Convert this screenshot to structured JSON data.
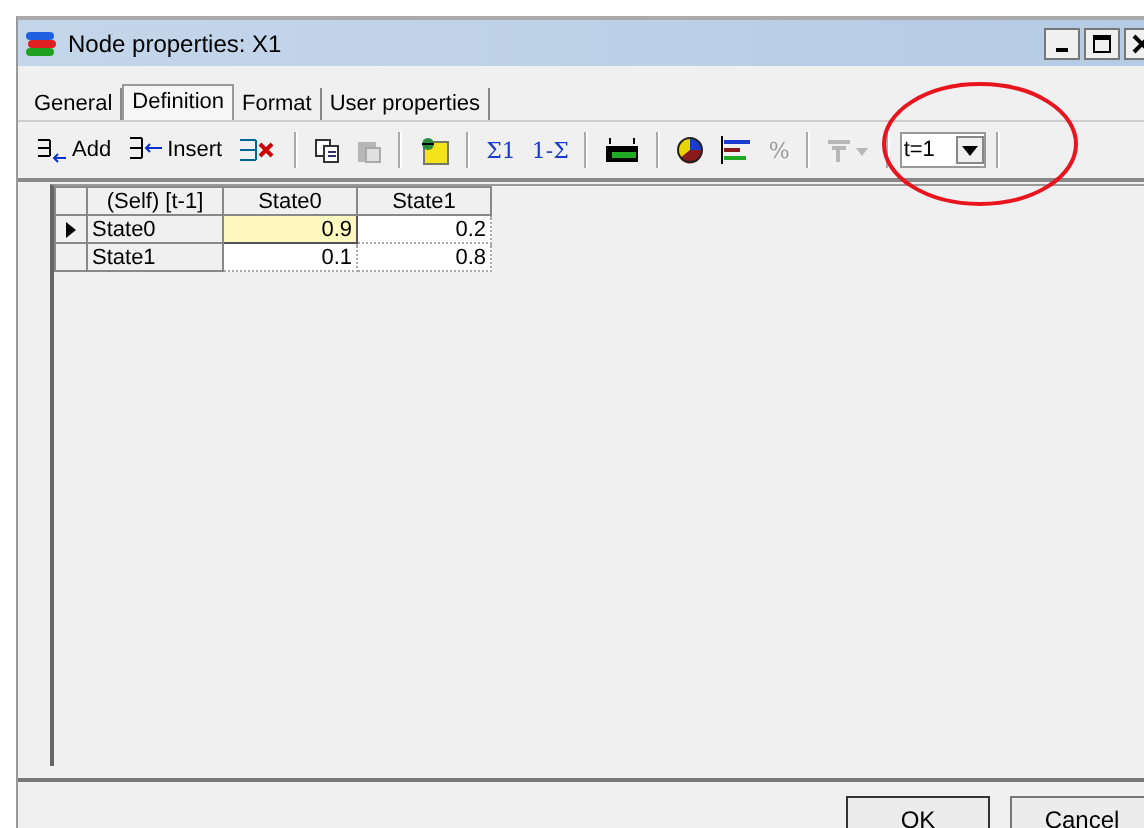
{
  "window": {
    "title": "Node properties: X1"
  },
  "tabs": [
    {
      "label": "General",
      "selected": false
    },
    {
      "label": "Definition",
      "selected": true
    },
    {
      "label": "Format",
      "selected": false
    },
    {
      "label": "User properties",
      "selected": false
    }
  ],
  "toolbar": [
    {
      "kind": "button",
      "label": "Add",
      "disabled": false
    },
    {
      "kind": "button",
      "label": "Insert",
      "disabled": false
    },
    {
      "kind": "button",
      "disabled": false
    },
    {
      "kind": "separator"
    },
    {
      "kind": "button",
      "disabled": false
    },
    {
      "kind": "button",
      "disabled": true
    },
    {
      "kind": "separator"
    },
    {
      "kind": "button",
      "disabled": false
    },
    {
      "kind": "separator"
    },
    {
      "kind": "button",
      "label": "Σ1",
      "disabled": false
    },
    {
      "kind": "button",
      "label": "1-Σ",
      "disabled": false
    },
    {
      "kind": "separator"
    },
    {
      "kind": "button",
      "disabled": false
    },
    {
      "kind": "separator"
    },
    {
      "kind": "button",
      "disabled": false
    },
    {
      "kind": "button",
      "disabled": false
    },
    {
      "kind": "button",
      "label": "%",
      "disabled": true
    },
    {
      "kind": "separator"
    },
    {
      "kind": "button",
      "disabled": true
    },
    {
      "kind": "separator"
    },
    {
      "kind": "combo",
      "value": "t=1"
    },
    {
      "kind": "separator"
    }
  ],
  "table": {
    "columns": [
      "(Self) [t-1]",
      "State0",
      "State1"
    ],
    "rows": [
      {
        "selected": true,
        "cells": [
          {
            "text": "State0"
          },
          {
            "text": "0.9",
            "selected": true
          },
          {
            "text": "0.2",
            "selected": false
          }
        ]
      },
      {
        "selected": false,
        "cells": [
          {
            "text": "State1"
          },
          {
            "text": "0.1",
            "selected": false
          },
          {
            "text": "0.8",
            "selected": false
          }
        ]
      }
    ]
  },
  "buttons": [
    "OK",
    "Cancel"
  ],
  "annotation": {
    "kind": "ellipse"
  }
}
